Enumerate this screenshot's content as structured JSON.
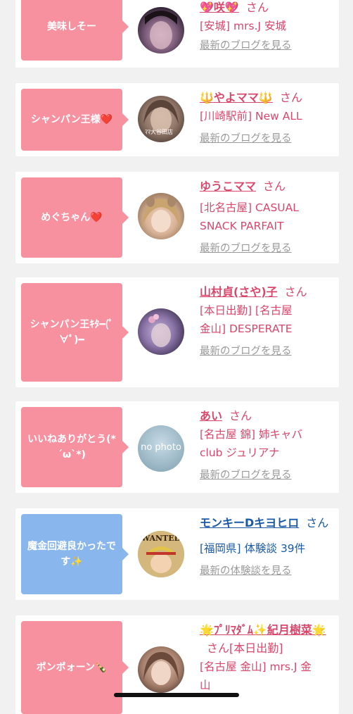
{
  "cards": [
    {
      "message": "美味しそー",
      "name": "💖咲💖",
      "san": "さん",
      "meta": "[安城] mrs.J 安城",
      "link": "最新のブログを見る"
    },
    {
      "message": "シャンパン王様❤️",
      "name": "🔱やよママ🔱",
      "san": "さん",
      "meta": "[川崎駅前] New ALL",
      "link": "最新のブログを見る",
      "avatar_caption": "ﾏﾏ大谷田店"
    },
    {
      "message": "めぐちゃん❤️",
      "name": "ゆうこママ",
      "san": "さん",
      "meta": "[北名古屋] CASUAL SNACK PARFAIT",
      "link": "最新のブログを見る"
    },
    {
      "message": "シャンパン王ｷﾀ━(ﾟ∀ﾟ)━",
      "name": "山村貞(さや)子",
      "san": "さん",
      "meta": "[本日出勤] [名古屋 金山] DESPERATE",
      "link": "最新のブログを見る"
    },
    {
      "message": "いいねありがとう(*´ω`*)",
      "name": "あい",
      "san": "さん",
      "meta": "[名古屋 錦] 姉キャバclub ジュリアナ",
      "link": "最新のブログを見る",
      "avatar_caption": "no photo"
    },
    {
      "message": "魔金回避良かったです✨",
      "name": "モンキーDキヨヒロ",
      "san": "さん",
      "meta": "[福岡県] 体験談 39件",
      "link": "最新の体験談を見る",
      "avatar_caption": "WANTED"
    },
    {
      "message": "ポンポォーン🍾",
      "name": "🌟ﾌﾟﾘﾏﾀﾞﾑ✨紀月樹菜🌟",
      "san": "さん[本日出勤]",
      "meta": "[名古屋 金山] mrs.J 金山"
    }
  ],
  "colors": {
    "pink_bubble": "#f7909f",
    "blue_bubble": "#8ab6ee",
    "pink_text": "#d9476b",
    "blue_text": "#1b5aa6",
    "link_gray": "#9a9a9a"
  }
}
